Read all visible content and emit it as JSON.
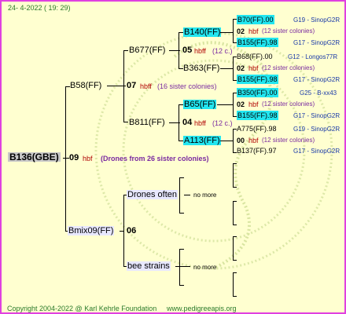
{
  "header": {
    "date": "24-  4-2022 ( 19: 29)"
  },
  "root": {
    "name": "B136(GBE)",
    "year": "09",
    "tag": "hbf",
    "note": "(Drones from 26 sister colonies)"
  },
  "gen1": [
    {
      "name": "B58(FF)"
    },
    {
      "name": "Bmix09(FF)",
      "year": "06"
    }
  ],
  "gen2": [
    {
      "name": "B677(FF)",
      "year": "05",
      "tag": "hbff",
      "note": "(12 c.)"
    },
    {
      "name": "B811(FF)",
      "year": "04",
      "tag": "hbff",
      "note": "(12 c.)"
    },
    {
      "name": "Drones often"
    },
    {
      "name": "bee strains"
    }
  ],
  "b58_info": {
    "year": "07",
    "tag": "hbff",
    "note": "(16 sister colonies)"
  },
  "gen3": [
    {
      "name": "B140(FF)"
    },
    {
      "name": "B363(FF)"
    },
    {
      "name": "B65(FF)"
    },
    {
      "name": "A113(FF)"
    }
  ],
  "no_more": "no more",
  "gen4": [
    {
      "left": "B70(FF).00",
      "right": "G19 - SinopG2R"
    },
    {
      "year": "02",
      "tag": "hbf",
      "note": "(12 sister colonies)"
    },
    {
      "left": "B155(FF).98",
      "right": "G17 - SinopG2R"
    },
    {
      "left": "B68(FF).00",
      "right": "G12 - Longos77R"
    },
    {
      "year": "02",
      "tag": "hbf",
      "note": "(12 sister colonies)"
    },
    {
      "left": "B155(FF).98",
      "right": "G17 - SinopG2R"
    },
    {
      "left": "B350(FF).00",
      "right": "G25 - B-xx43"
    },
    {
      "year": "02",
      "tag": "hbf",
      "note": "(12 sister colonies)"
    },
    {
      "left": "B155(FF).98",
      "right": "G17 - SinopG2R"
    },
    {
      "left": "A775(FF).98",
      "right": "G19 - SinopG2R"
    },
    {
      "year": "00",
      "tag": "hbf",
      "note": "(12 sister colonies)"
    },
    {
      "left": "B137(FF).97",
      "right": "G17 - SinopG2R"
    }
  ],
  "footer": {
    "copyright": "Copyright 2004-2022 @ Karl Kehrle Foundation",
    "url": "www.pedigreeapis.org"
  },
  "colors": {
    "border": "#e040e0",
    "background": "#ffffd0",
    "highlight": "#22e6f0",
    "root_bg": "#c8c8c8",
    "footer_green": "#2a7a2a"
  }
}
